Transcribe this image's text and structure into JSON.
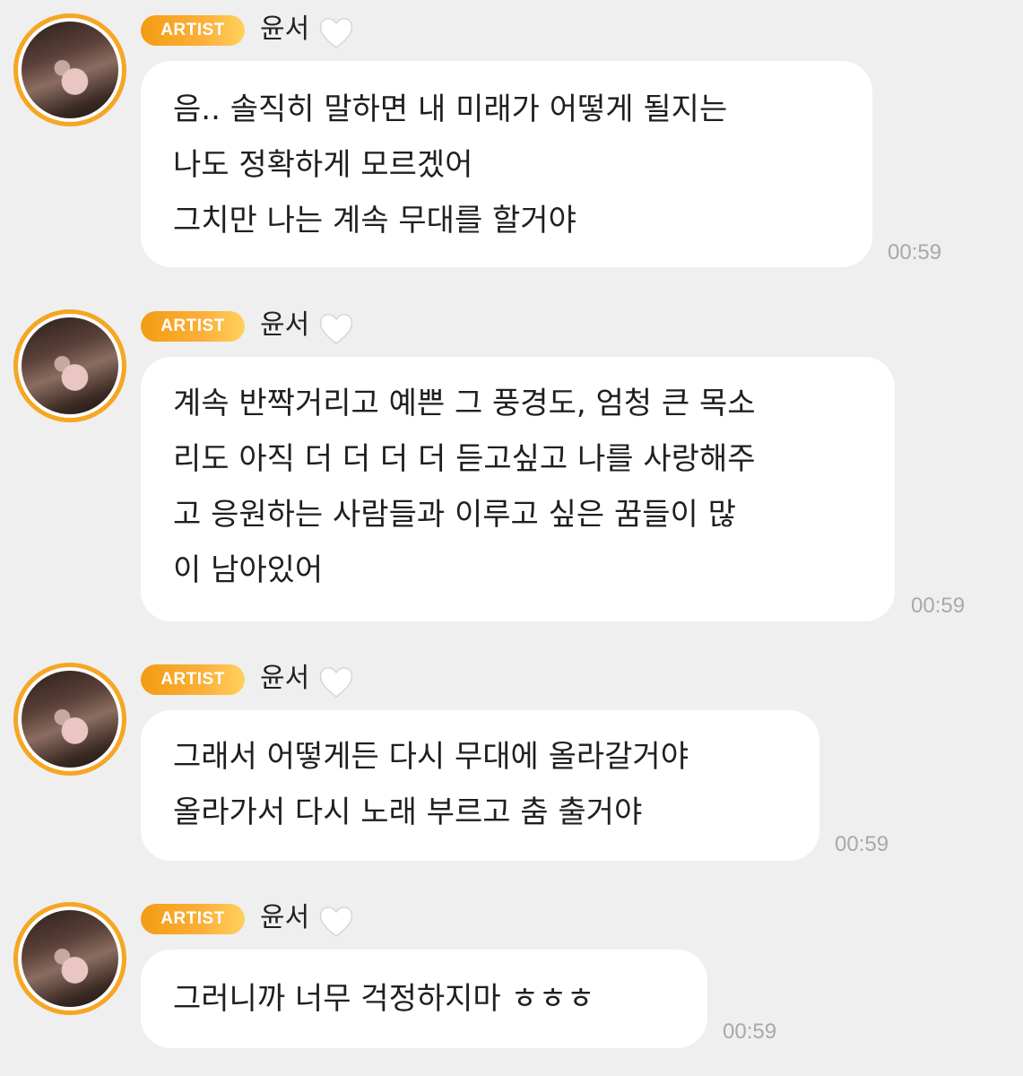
{
  "messages": [
    {
      "badge": "ARTIST",
      "sender": "윤서",
      "lines": [
        "음.. 솔직히 말하면 내 미래가 어떻게 될지는",
        "나도 정확하게 모르겠어",
        "그치만 나는 계속 무대를 할거야"
      ],
      "time": "00:59"
    },
    {
      "badge": "ARTIST",
      "sender": "윤서",
      "lines": [
        "계속 반짝거리고 예쁜 그 풍경도, 엄청 큰 목소",
        "리도 아직 더 더 더 더 듣고싶고 나를 사랑해주",
        "고 응원하는 사람들과 이루고 싶은 꿈들이 많",
        "이 남아있어"
      ],
      "time": "00:59"
    },
    {
      "badge": "ARTIST",
      "sender": "윤서",
      "lines": [
        "그래서 어떻게든 다시 무대에 올라갈거야",
        "올라가서 다시 노래 부르고 춤 출거야"
      ],
      "time": "00:59"
    },
    {
      "badge": "ARTIST",
      "sender": "윤서",
      "lines": [
        "그러니까 너무 걱정하지마 ㅎㅎㅎ"
      ],
      "time": "00:59"
    }
  ],
  "colors": {
    "background": "#efefef",
    "badge": "#f5a623",
    "bubble": "#ffffff",
    "timestamp": "#a9a9a9"
  },
  "icons": {
    "heart": "white-heart-icon"
  }
}
